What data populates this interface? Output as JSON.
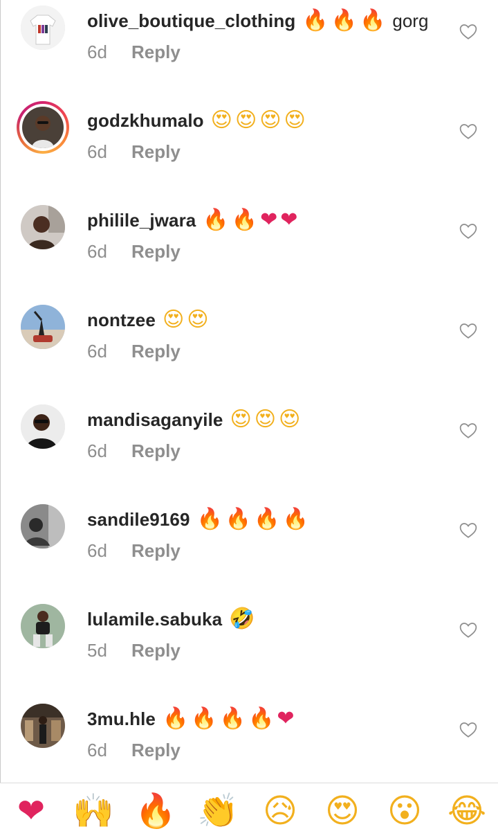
{
  "comments": [
    {
      "username": "olive_boutique_clothing",
      "emojis": [
        "🔥",
        "🔥",
        "🔥"
      ],
      "text": "gorg",
      "time": "6d",
      "reply": "Reply",
      "avatar": "avatar-shirt"
    },
    {
      "username": "godzkhumalo",
      "emojis": [
        "😍",
        "😍",
        "😍",
        "😍"
      ],
      "text": "",
      "time": "6d",
      "reply": "Reply",
      "avatar": "avatar-story"
    },
    {
      "username": "philile_jwara",
      "emojis": [
        "🔥",
        "🔥",
        "❤",
        "❤"
      ],
      "text": "",
      "time": "6d",
      "reply": "Reply",
      "avatar": "avatar-person"
    },
    {
      "username": "nontzee",
      "emojis": [
        "😍",
        "😍"
      ],
      "text": "",
      "time": "6d",
      "reply": "Reply",
      "avatar": "avatar-outdoor"
    },
    {
      "username": "mandisaganyile",
      "emojis": [
        "😍",
        "😍",
        "😍"
      ],
      "text": "",
      "time": "6d",
      "reply": "Reply",
      "avatar": "avatar-selfie"
    },
    {
      "username": "sandile9169",
      "emojis": [
        "🔥",
        "🔥",
        "🔥",
        "🔥"
      ],
      "text": "",
      "time": "6d",
      "reply": "Reply",
      "avatar": "avatar-bw"
    },
    {
      "username": "lulamile.sabuka",
      "emojis": [
        "🤣"
      ],
      "text": "",
      "time": "5d",
      "reply": "Reply",
      "avatar": "avatar-sitting"
    },
    {
      "username": "3mu.hle",
      "emojis": [
        "🔥",
        "🔥",
        "🔥",
        "🔥",
        "❤"
      ],
      "text": "",
      "time": "6d",
      "reply": "Reply",
      "avatar": "avatar-street"
    }
  ],
  "reactions": [
    {
      "emoji": "❤",
      "name": "heart"
    },
    {
      "emoji": "🙌",
      "name": "raised-hands"
    },
    {
      "emoji": "🔥",
      "name": "fire"
    },
    {
      "emoji": "👏",
      "name": "clapping-hands"
    },
    {
      "emoji": "😥",
      "name": "sad"
    },
    {
      "emoji": "😍",
      "name": "heart-eyes"
    },
    {
      "emoji": "😮",
      "name": "surprised"
    },
    {
      "emoji": "😂",
      "name": "tears-of-joy"
    }
  ],
  "colors": {
    "text": "#262626",
    "meta": "#8e8e8e",
    "story_ring": "#d3246e"
  }
}
